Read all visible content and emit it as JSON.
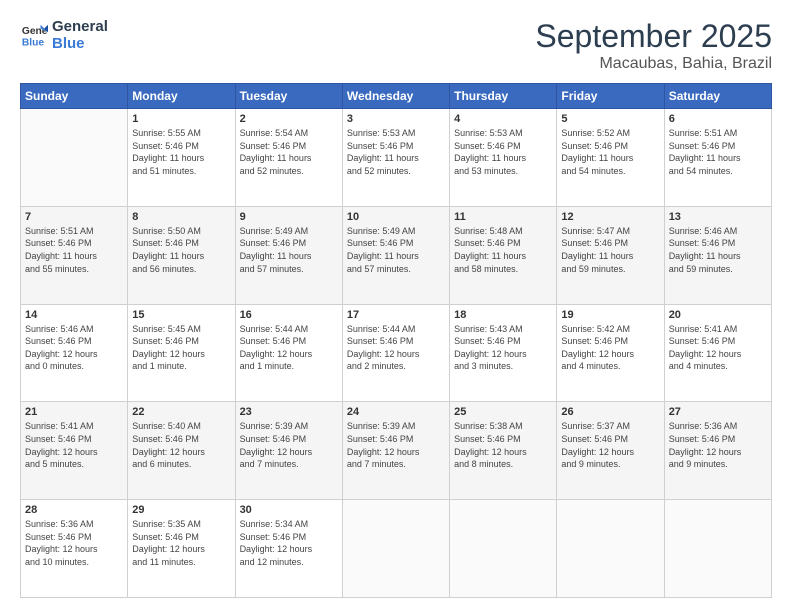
{
  "logo": {
    "line1": "General",
    "line2": "Blue"
  },
  "title": "September 2025",
  "location": "Macaubas, Bahia, Brazil",
  "weekdays": [
    "Sunday",
    "Monday",
    "Tuesday",
    "Wednesday",
    "Thursday",
    "Friday",
    "Saturday"
  ],
  "weeks": [
    [
      {
        "day": "",
        "info": ""
      },
      {
        "day": "1",
        "info": "Sunrise: 5:55 AM\nSunset: 5:46 PM\nDaylight: 11 hours\nand 51 minutes."
      },
      {
        "day": "2",
        "info": "Sunrise: 5:54 AM\nSunset: 5:46 PM\nDaylight: 11 hours\nand 52 minutes."
      },
      {
        "day": "3",
        "info": "Sunrise: 5:53 AM\nSunset: 5:46 PM\nDaylight: 11 hours\nand 52 minutes."
      },
      {
        "day": "4",
        "info": "Sunrise: 5:53 AM\nSunset: 5:46 PM\nDaylight: 11 hours\nand 53 minutes."
      },
      {
        "day": "5",
        "info": "Sunrise: 5:52 AM\nSunset: 5:46 PM\nDaylight: 11 hours\nand 54 minutes."
      },
      {
        "day": "6",
        "info": "Sunrise: 5:51 AM\nSunset: 5:46 PM\nDaylight: 11 hours\nand 54 minutes."
      }
    ],
    [
      {
        "day": "7",
        "info": "Sunrise: 5:51 AM\nSunset: 5:46 PM\nDaylight: 11 hours\nand 55 minutes."
      },
      {
        "day": "8",
        "info": "Sunrise: 5:50 AM\nSunset: 5:46 PM\nDaylight: 11 hours\nand 56 minutes."
      },
      {
        "day": "9",
        "info": "Sunrise: 5:49 AM\nSunset: 5:46 PM\nDaylight: 11 hours\nand 57 minutes."
      },
      {
        "day": "10",
        "info": "Sunrise: 5:49 AM\nSunset: 5:46 PM\nDaylight: 11 hours\nand 57 minutes."
      },
      {
        "day": "11",
        "info": "Sunrise: 5:48 AM\nSunset: 5:46 PM\nDaylight: 11 hours\nand 58 minutes."
      },
      {
        "day": "12",
        "info": "Sunrise: 5:47 AM\nSunset: 5:46 PM\nDaylight: 11 hours\nand 59 minutes."
      },
      {
        "day": "13",
        "info": "Sunrise: 5:46 AM\nSunset: 5:46 PM\nDaylight: 11 hours\nand 59 minutes."
      }
    ],
    [
      {
        "day": "14",
        "info": "Sunrise: 5:46 AM\nSunset: 5:46 PM\nDaylight: 12 hours\nand 0 minutes."
      },
      {
        "day": "15",
        "info": "Sunrise: 5:45 AM\nSunset: 5:46 PM\nDaylight: 12 hours\nand 1 minute."
      },
      {
        "day": "16",
        "info": "Sunrise: 5:44 AM\nSunset: 5:46 PM\nDaylight: 12 hours\nand 1 minute."
      },
      {
        "day": "17",
        "info": "Sunrise: 5:44 AM\nSunset: 5:46 PM\nDaylight: 12 hours\nand 2 minutes."
      },
      {
        "day": "18",
        "info": "Sunrise: 5:43 AM\nSunset: 5:46 PM\nDaylight: 12 hours\nand 3 minutes."
      },
      {
        "day": "19",
        "info": "Sunrise: 5:42 AM\nSunset: 5:46 PM\nDaylight: 12 hours\nand 4 minutes."
      },
      {
        "day": "20",
        "info": "Sunrise: 5:41 AM\nSunset: 5:46 PM\nDaylight: 12 hours\nand 4 minutes."
      }
    ],
    [
      {
        "day": "21",
        "info": "Sunrise: 5:41 AM\nSunset: 5:46 PM\nDaylight: 12 hours\nand 5 minutes."
      },
      {
        "day": "22",
        "info": "Sunrise: 5:40 AM\nSunset: 5:46 PM\nDaylight: 12 hours\nand 6 minutes."
      },
      {
        "day": "23",
        "info": "Sunrise: 5:39 AM\nSunset: 5:46 PM\nDaylight: 12 hours\nand 7 minutes."
      },
      {
        "day": "24",
        "info": "Sunrise: 5:39 AM\nSunset: 5:46 PM\nDaylight: 12 hours\nand 7 minutes."
      },
      {
        "day": "25",
        "info": "Sunrise: 5:38 AM\nSunset: 5:46 PM\nDaylight: 12 hours\nand 8 minutes."
      },
      {
        "day": "26",
        "info": "Sunrise: 5:37 AM\nSunset: 5:46 PM\nDaylight: 12 hours\nand 9 minutes."
      },
      {
        "day": "27",
        "info": "Sunrise: 5:36 AM\nSunset: 5:46 PM\nDaylight: 12 hours\nand 9 minutes."
      }
    ],
    [
      {
        "day": "28",
        "info": "Sunrise: 5:36 AM\nSunset: 5:46 PM\nDaylight: 12 hours\nand 10 minutes."
      },
      {
        "day": "29",
        "info": "Sunrise: 5:35 AM\nSunset: 5:46 PM\nDaylight: 12 hours\nand 11 minutes."
      },
      {
        "day": "30",
        "info": "Sunrise: 5:34 AM\nSunset: 5:46 PM\nDaylight: 12 hours\nand 12 minutes."
      },
      {
        "day": "",
        "info": ""
      },
      {
        "day": "",
        "info": ""
      },
      {
        "day": "",
        "info": ""
      },
      {
        "day": "",
        "info": ""
      }
    ]
  ]
}
